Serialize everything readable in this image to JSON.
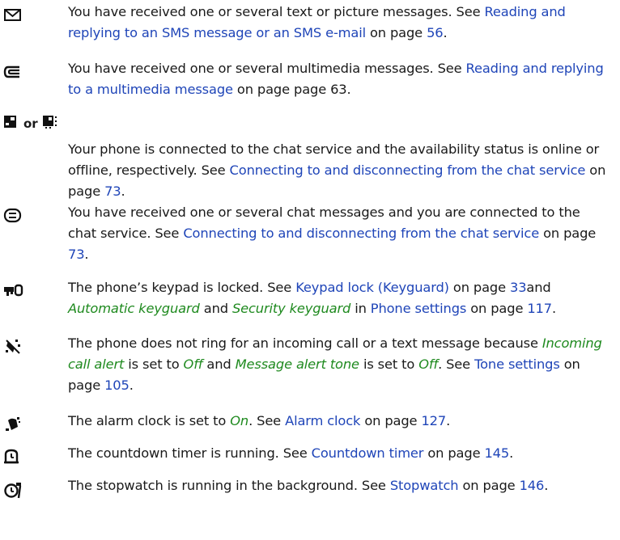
{
  "entries": [
    {
      "icon": "envelope-icon",
      "parts": [
        {
          "t": "You have received one or several text or picture messages. See ",
          "s": "plain"
        },
        {
          "t": "Reading and replying to an SMS message or an SMS e-mail",
          "s": "link"
        },
        {
          "t": " on page ",
          "s": "plain"
        },
        {
          "t": "56",
          "s": "link"
        },
        {
          "t": ".",
          "s": "plain"
        }
      ]
    },
    {
      "icon": "multimedia-message-icon",
      "parts": [
        {
          "t": "You have received one or several multimedia messages. See ",
          "s": "plain"
        },
        {
          "t": "Reading and replying to a multimedia message",
          "s": "link"
        },
        {
          "t": " on page page 63.",
          "s": "plain"
        }
      ]
    },
    {
      "icon": "chat-status-icons",
      "or_text": "or",
      "parts": [
        {
          "t": "Your phone is connected to the chat service and the availability status is online or offline, respectively. See ",
          "s": "plain"
        },
        {
          "t": "Connecting to and disconnecting from the chat service",
          "s": "link"
        },
        {
          "t": " on page ",
          "s": "plain"
        },
        {
          "t": "73",
          "s": "link"
        },
        {
          "t": ".",
          "s": "plain"
        }
      ]
    },
    {
      "icon": "chat-message-icon",
      "parts": [
        {
          "t": "You have received one or several chat messages and you are connected to the chat service. See ",
          "s": "plain"
        },
        {
          "t": "Connecting to and disconnecting from the chat service",
          "s": "link"
        },
        {
          "t": " on page ",
          "s": "plain"
        },
        {
          "t": "73",
          "s": "link"
        },
        {
          "t": ".",
          "s": "plain"
        }
      ]
    },
    {
      "icon": "keypad-lock-icon",
      "parts": [
        {
          "t": "The phone’s keypad is locked. See ",
          "s": "plain"
        },
        {
          "t": "Keypad lock (Keyguard)",
          "s": "link"
        },
        {
          "t": " on page ",
          "s": "plain"
        },
        {
          "t": "33",
          "s": "link"
        },
        {
          "t": "and ",
          "s": "plain"
        },
        {
          "t": "Automatic keyguard",
          "s": "opt"
        },
        {
          "t": " and ",
          "s": "plain"
        },
        {
          "t": "Security keyguard",
          "s": "opt"
        },
        {
          "t": " in ",
          "s": "plain"
        },
        {
          "t": "Phone settings",
          "s": "link"
        },
        {
          "t": " on page ",
          "s": "plain"
        },
        {
          "t": "117",
          "s": "link"
        },
        {
          "t": ".",
          "s": "plain"
        }
      ]
    },
    {
      "icon": "silent-icon",
      "parts": [
        {
          "t": "The phone does not ring for an incoming call or a text message because ",
          "s": "plain"
        },
        {
          "t": "Incoming call alert",
          "s": "opt"
        },
        {
          "t": " is set to ",
          "s": "plain"
        },
        {
          "t": "Off",
          "s": "opt"
        },
        {
          "t": " and ",
          "s": "plain"
        },
        {
          "t": "Message alert tone",
          "s": "opt"
        },
        {
          "t": " is set to ",
          "s": "plain"
        },
        {
          "t": "Off",
          "s": "opt"
        },
        {
          "t": ". See ",
          "s": "plain"
        },
        {
          "t": "Tone settings",
          "s": "link"
        },
        {
          "t": " on page ",
          "s": "plain"
        },
        {
          "t": "105",
          "s": "link"
        },
        {
          "t": ".",
          "s": "plain"
        }
      ]
    },
    {
      "icon": "alarm-clock-icon",
      "parts": [
        {
          "t": "The alarm clock is set to ",
          "s": "plain"
        },
        {
          "t": "On",
          "s": "opt"
        },
        {
          "t": ". See ",
          "s": "plain"
        },
        {
          "t": "Alarm clock",
          "s": "link"
        },
        {
          "t": " on page ",
          "s": "plain"
        },
        {
          "t": "127",
          "s": "link"
        },
        {
          "t": ".",
          "s": "plain"
        }
      ]
    },
    {
      "icon": "countdown-timer-icon",
      "parts": [
        {
          "t": "The countdown timer is running. See ",
          "s": "plain"
        },
        {
          "t": "Countdown timer",
          "s": "link"
        },
        {
          "t": " on page ",
          "s": "plain"
        },
        {
          "t": "145",
          "s": "link"
        },
        {
          "t": ".",
          "s": "plain"
        }
      ]
    },
    {
      "icon": "stopwatch-icon",
      "parts": [
        {
          "t": "The stopwatch is running in the background. See ",
          "s": "plain"
        },
        {
          "t": "Stopwatch",
          "s": "link"
        },
        {
          "t": " on page ",
          "s": "plain"
        },
        {
          "t": "146",
          "s": "link"
        },
        {
          "t": ".",
          "s": "plain"
        }
      ]
    }
  ],
  "colors": {
    "link": "#1f45b8",
    "option": "#1f8a1f",
    "text": "#1a1a1a"
  }
}
